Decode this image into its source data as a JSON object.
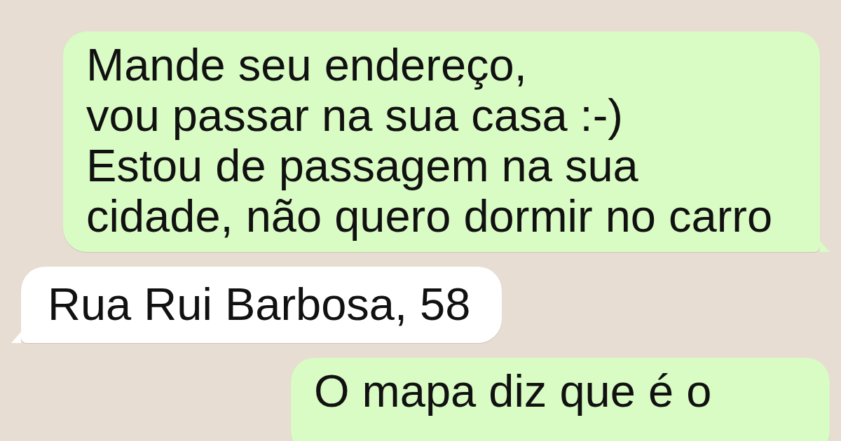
{
  "messages": [
    {
      "kind": "outgoing",
      "text": "Mande seu endereço,\nvou passar na sua casa :-)\nEstou de passagem na sua\ncidade, não quero dormir no carro"
    },
    {
      "kind": "incoming",
      "text": "Rua Rui Barbosa, 58"
    },
    {
      "kind": "outgoing",
      "text": "O mapa diz que é o"
    }
  ]
}
